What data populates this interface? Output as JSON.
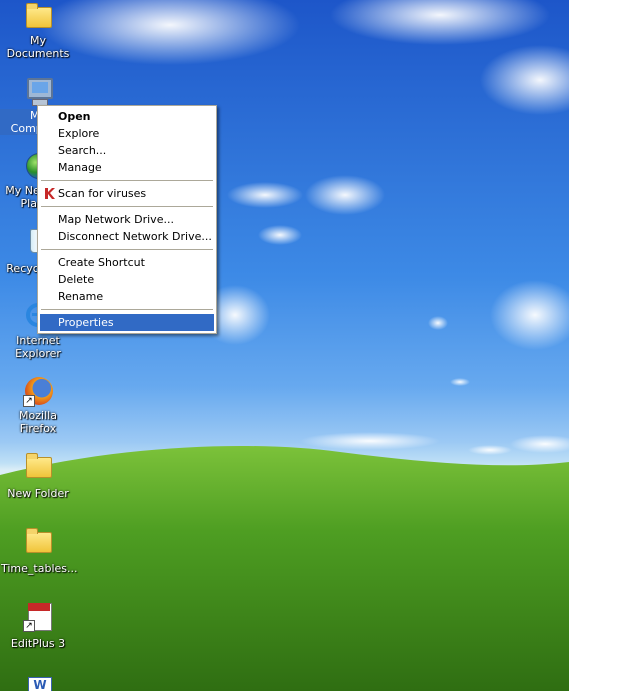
{
  "desktop": {
    "icons": [
      {
        "label": "My Documents",
        "icon": "folder-documents-icon"
      },
      {
        "label": "My Computer",
        "icon": "my-computer-icon"
      },
      {
        "label": "My Network Places",
        "icon": "network-places-icon"
      },
      {
        "label": "Recycle Bin",
        "icon": "recycle-bin-icon"
      },
      {
        "label": "Internet Explorer",
        "icon": "internet-explorer-icon"
      },
      {
        "label": "Mozilla Firefox",
        "icon": "firefox-icon"
      },
      {
        "label": "New Folder",
        "icon": "folder-icon"
      },
      {
        "label": "Time_tables...",
        "icon": "folder-icon"
      },
      {
        "label": "EditPlus 3",
        "icon": "editplus-icon"
      }
    ]
  },
  "context_menu": {
    "items": [
      {
        "label": "Open",
        "bold": true
      },
      {
        "label": "Explore"
      },
      {
        "label": "Search..."
      },
      {
        "label": "Manage"
      },
      {
        "label": "Scan for viruses",
        "icon": "kaspersky-icon"
      },
      {
        "label": "Map Network Drive..."
      },
      {
        "label": "Disconnect Network Drive..."
      },
      {
        "label": "Create Shortcut"
      },
      {
        "label": "Delete"
      },
      {
        "label": "Rename"
      },
      {
        "label": "Properties",
        "highlighted": true
      }
    ]
  },
  "colors": {
    "selection": "#316ac5",
    "menu_border": "#aca899"
  }
}
